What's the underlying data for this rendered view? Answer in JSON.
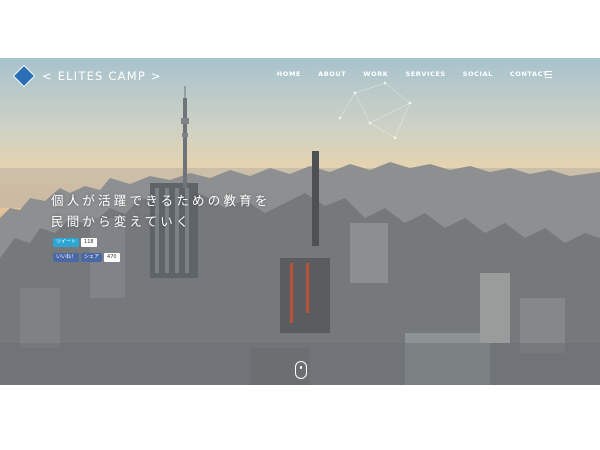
{
  "brand": {
    "name": "< ELITES CAMP >"
  },
  "nav": {
    "items": [
      {
        "label": "HOME"
      },
      {
        "label": "ABOUT"
      },
      {
        "label": "WORK"
      },
      {
        "label": "SERVICES"
      },
      {
        "label": "SOCIAL"
      },
      {
        "label": "CONTACT"
      }
    ]
  },
  "hero": {
    "line1": "個人が活躍できるための教育を",
    "line2": "民間から変えていく"
  },
  "social": {
    "tweet_label": "ツイート",
    "tweet_count": "118",
    "like_label": "いいね！",
    "share_label": "シェア",
    "share_count": "470"
  },
  "icons": {
    "logo": "diamond-logo-icon",
    "menu": "hamburger-menu-icon",
    "scroll": "mouse-scroll-icon"
  },
  "colors": {
    "accent": "#2a6fb5",
    "twitter": "#2ba7d6",
    "facebook": "#4a67a6"
  }
}
